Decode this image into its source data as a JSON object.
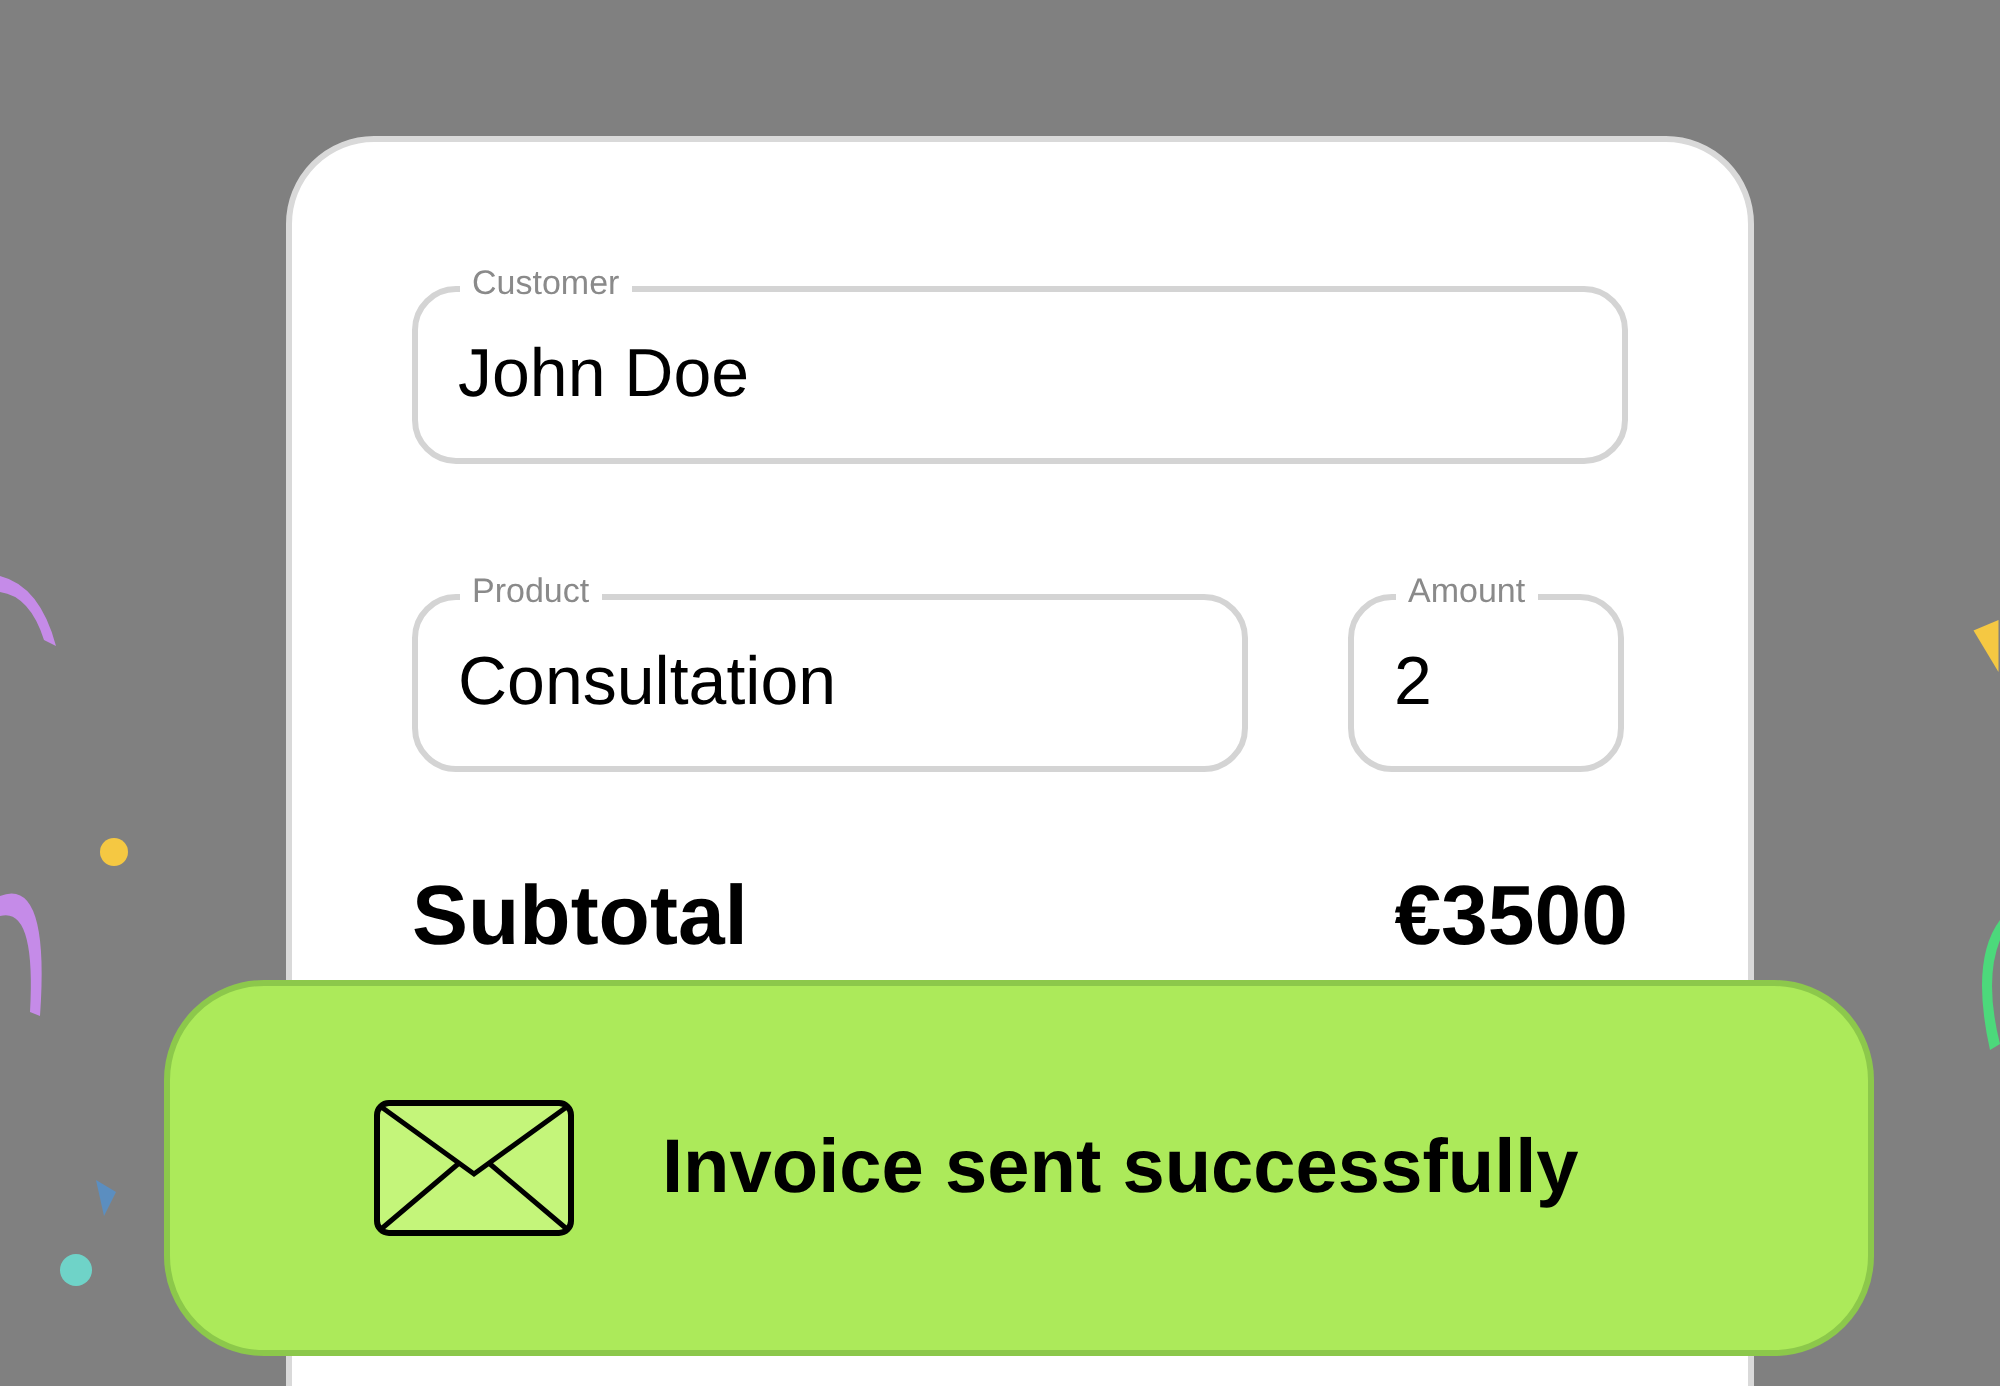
{
  "form": {
    "fields": [
      {
        "label": "Customer",
        "value": "John Doe"
      },
      {
        "label": "Product",
        "value": "Consultation"
      },
      {
        "label": "Amount",
        "value": "2"
      }
    ],
    "subtotal": {
      "label": "Subtotal",
      "value": "€3500"
    }
  },
  "toast": {
    "message": "Invoice sent successfully"
  }
}
